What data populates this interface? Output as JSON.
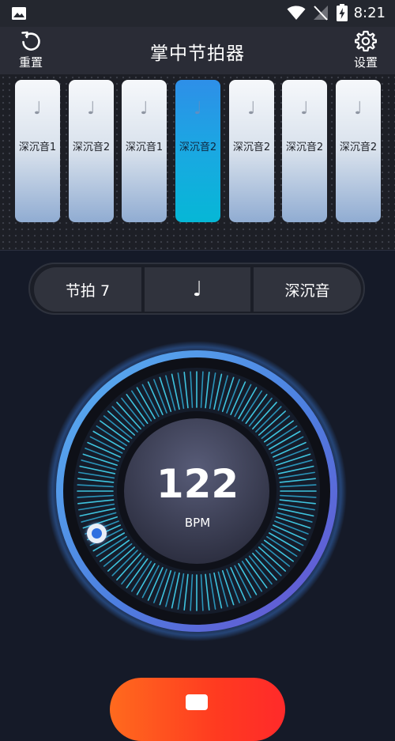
{
  "status_bar": {
    "time": "8:21",
    "icons": [
      "image-icon",
      "wifi-icon",
      "signal-off-icon",
      "battery-charging-icon"
    ]
  },
  "header": {
    "reset_label": "重置",
    "title": "掌中节拍器",
    "settings_label": "设置"
  },
  "beats": [
    {
      "note": "♩",
      "label": "深沉音1",
      "active": false
    },
    {
      "note": "♩",
      "label": "深沉音2",
      "active": false
    },
    {
      "note": "♩",
      "label": "深沉音1",
      "active": false
    },
    {
      "note": "♩",
      "label": "深沉音2",
      "active": true
    },
    {
      "note": "♩",
      "label": "深沉音2",
      "active": false
    },
    {
      "note": "♩",
      "label": "深沉音2",
      "active": false
    },
    {
      "note": "♩",
      "label": "深沉音2",
      "active": false
    }
  ],
  "controls": {
    "beat_label": "节拍 7",
    "note_symbol": "♩",
    "sound_label": "深沉音"
  },
  "tempo": {
    "bpm": "122",
    "unit": "BPM"
  },
  "colors": {
    "accent": "#1aa8e2",
    "play": "#ff3b20",
    "background": "#151a28"
  }
}
